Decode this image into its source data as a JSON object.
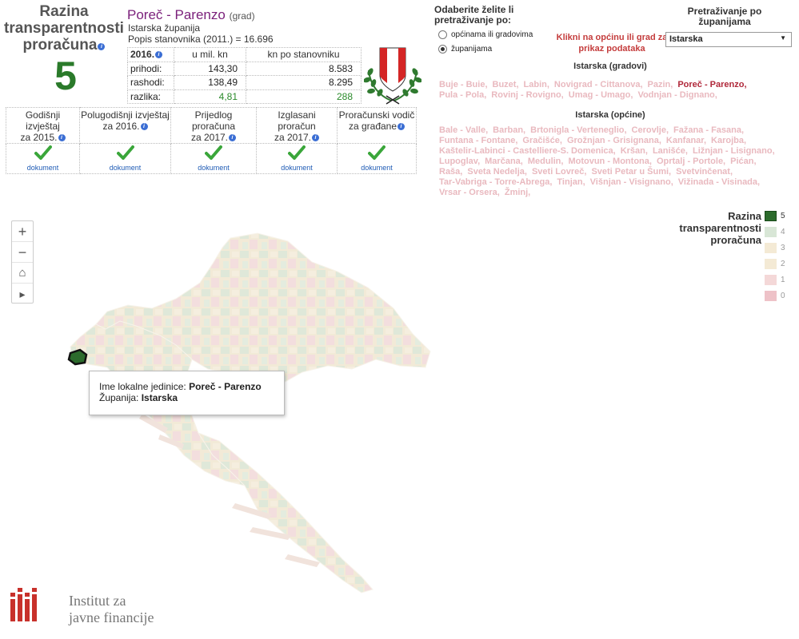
{
  "left_title": "Razina transparentnosti proračuna",
  "score": "5",
  "unit": {
    "name": "Poreč - Parenzo",
    "type": "(grad)",
    "county": "Istarska županija",
    "population": "Popis stanovnika (2011.) = 16.696"
  },
  "finance": {
    "year": "2016.",
    "col_mil": "u mil. kn",
    "col_per": "kn po stanovniku",
    "rows": [
      {
        "label": "prihodi:",
        "mil": "143,30",
        "per": "8.583"
      },
      {
        "label": "rashodi:",
        "mil": "138,49",
        "per": "8.295"
      },
      {
        "label": "razlika:",
        "mil": "4,81",
        "per": "288"
      }
    ]
  },
  "documents": [
    {
      "line1": "Godišnji izvještaj",
      "line2": "za 2015.",
      "link": "dokument"
    },
    {
      "line1": "Polugodišnji izvještaj",
      "line2": "za 2016.",
      "link": "dokument"
    },
    {
      "line1": "Prijedlog proračuna",
      "line2": "za 2017.",
      "link": "dokument"
    },
    {
      "line1": "Izglasani proračun",
      "line2": "za 2017.",
      "link": "dokument"
    },
    {
      "line1": "Proračunski vodič",
      "line2": "za građane",
      "link": "dokument"
    }
  ],
  "search_mode": {
    "question": "Odaberite želite li pretraživanje po:",
    "option1": "općinama ili gradovima",
    "option2": "županijama",
    "selected": "option2"
  },
  "click_hint": "Klikni na općinu ili grad za prikaz podataka",
  "county_search": {
    "label": "Pretraživanje po županijama",
    "selected": "Istarska"
  },
  "cities_title": "Istarska (gradovi)",
  "cities": [
    "Buje - Buie,",
    "Buzet,",
    "Labin,",
    "Novigrad - Cittanova,",
    "Pazin,",
    "Poreč - Parenzo,",
    "Pula - Pola,",
    "Rovinj - Rovigno,",
    "Umag - Umago,",
    "Vodnjan - Dignano,"
  ],
  "selected_city": "Poreč - Parenzo,",
  "municipalities_title": "Istarska (općine)",
  "municipalities": [
    "Bale - Valle,",
    "Barban,",
    "Brtonigla - Verteneglio,",
    "Cerovlje,",
    "Fažana - Fasana,",
    "Funtana - Fontane,",
    "Gračišće,",
    "Grožnjan - Grisignana,",
    "Kanfanar,",
    "Karojba,",
    "Kaštelir-Labinci - Castelliere-S. Domenica,",
    "Kršan,",
    "Lanišće,",
    "Ližnjan - Lisignano,",
    "Lupoglav,",
    "Marčana,",
    "Medulin,",
    "Motovun - Montona,",
    "Oprtalj - Portole,",
    "Pićan,",
    "Raša,",
    "Sveta Nedelja,",
    "Sveti Lovreč,",
    "Sveti Petar u Šumi,",
    "Svetvinčenat,",
    "Tar-Vabriga - Torre-Abrega,",
    "Tinjan,",
    "Višnjan - Visignano,",
    "Vižinada - Visinada,",
    "Vrsar - Orsera,",
    "Žminj,"
  ],
  "map_controls": {
    "zoom_in": "+",
    "zoom_out": "−",
    "home": "⌂",
    "play": "▸"
  },
  "legend": {
    "title": "Razina transparentnosti proračuna",
    "items": [
      {
        "label": "5",
        "color": "#2c6b2c"
      },
      {
        "label": "4",
        "color": "#d8e6d6"
      },
      {
        "label": "3",
        "color": "#f4ead5"
      },
      {
        "label": "2",
        "color": "#f4ead5"
      },
      {
        "label": "1",
        "color": "#f4d8d8"
      },
      {
        "label": "0",
        "color": "#eec2c8"
      }
    ]
  },
  "tooltip": {
    "name_label": "Ime lokalne jedinice: ",
    "name_value": "Poreč - Parenzo",
    "county_label": "Županija: ",
    "county_value": "Istarska"
  },
  "logo": {
    "line1": "Institut za",
    "line2": "javne financije",
    "color": "#c8312b"
  }
}
